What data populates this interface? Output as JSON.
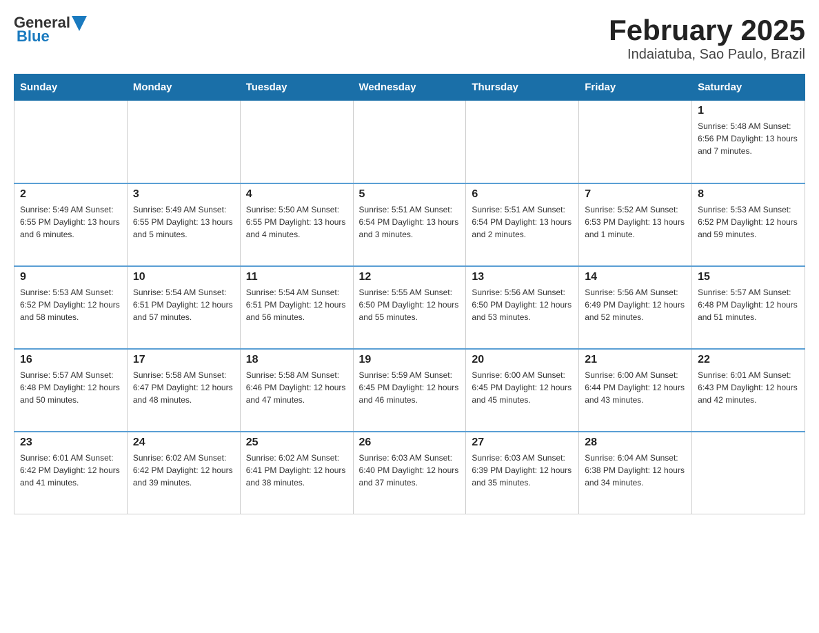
{
  "header": {
    "logo_general": "General",
    "logo_blue": "Blue",
    "month_title": "February 2025",
    "location": "Indaiatuba, Sao Paulo, Brazil"
  },
  "weekdays": [
    "Sunday",
    "Monday",
    "Tuesday",
    "Wednesday",
    "Thursday",
    "Friday",
    "Saturday"
  ],
  "rows": [
    {
      "cells": [
        {
          "day": "",
          "info": ""
        },
        {
          "day": "",
          "info": ""
        },
        {
          "day": "",
          "info": ""
        },
        {
          "day": "",
          "info": ""
        },
        {
          "day": "",
          "info": ""
        },
        {
          "day": "",
          "info": ""
        },
        {
          "day": "1",
          "info": "Sunrise: 5:48 AM\nSunset: 6:56 PM\nDaylight: 13 hours and 7 minutes."
        }
      ]
    },
    {
      "cells": [
        {
          "day": "2",
          "info": "Sunrise: 5:49 AM\nSunset: 6:55 PM\nDaylight: 13 hours and 6 minutes."
        },
        {
          "day": "3",
          "info": "Sunrise: 5:49 AM\nSunset: 6:55 PM\nDaylight: 13 hours and 5 minutes."
        },
        {
          "day": "4",
          "info": "Sunrise: 5:50 AM\nSunset: 6:55 PM\nDaylight: 13 hours and 4 minutes."
        },
        {
          "day": "5",
          "info": "Sunrise: 5:51 AM\nSunset: 6:54 PM\nDaylight: 13 hours and 3 minutes."
        },
        {
          "day": "6",
          "info": "Sunrise: 5:51 AM\nSunset: 6:54 PM\nDaylight: 13 hours and 2 minutes."
        },
        {
          "day": "7",
          "info": "Sunrise: 5:52 AM\nSunset: 6:53 PM\nDaylight: 13 hours and 1 minute."
        },
        {
          "day": "8",
          "info": "Sunrise: 5:53 AM\nSunset: 6:52 PM\nDaylight: 12 hours and 59 minutes."
        }
      ]
    },
    {
      "cells": [
        {
          "day": "9",
          "info": "Sunrise: 5:53 AM\nSunset: 6:52 PM\nDaylight: 12 hours and 58 minutes."
        },
        {
          "day": "10",
          "info": "Sunrise: 5:54 AM\nSunset: 6:51 PM\nDaylight: 12 hours and 57 minutes."
        },
        {
          "day": "11",
          "info": "Sunrise: 5:54 AM\nSunset: 6:51 PM\nDaylight: 12 hours and 56 minutes."
        },
        {
          "day": "12",
          "info": "Sunrise: 5:55 AM\nSunset: 6:50 PM\nDaylight: 12 hours and 55 minutes."
        },
        {
          "day": "13",
          "info": "Sunrise: 5:56 AM\nSunset: 6:50 PM\nDaylight: 12 hours and 53 minutes."
        },
        {
          "day": "14",
          "info": "Sunrise: 5:56 AM\nSunset: 6:49 PM\nDaylight: 12 hours and 52 minutes."
        },
        {
          "day": "15",
          "info": "Sunrise: 5:57 AM\nSunset: 6:48 PM\nDaylight: 12 hours and 51 minutes."
        }
      ]
    },
    {
      "cells": [
        {
          "day": "16",
          "info": "Sunrise: 5:57 AM\nSunset: 6:48 PM\nDaylight: 12 hours and 50 minutes."
        },
        {
          "day": "17",
          "info": "Sunrise: 5:58 AM\nSunset: 6:47 PM\nDaylight: 12 hours and 48 minutes."
        },
        {
          "day": "18",
          "info": "Sunrise: 5:58 AM\nSunset: 6:46 PM\nDaylight: 12 hours and 47 minutes."
        },
        {
          "day": "19",
          "info": "Sunrise: 5:59 AM\nSunset: 6:45 PM\nDaylight: 12 hours and 46 minutes."
        },
        {
          "day": "20",
          "info": "Sunrise: 6:00 AM\nSunset: 6:45 PM\nDaylight: 12 hours and 45 minutes."
        },
        {
          "day": "21",
          "info": "Sunrise: 6:00 AM\nSunset: 6:44 PM\nDaylight: 12 hours and 43 minutes."
        },
        {
          "day": "22",
          "info": "Sunrise: 6:01 AM\nSunset: 6:43 PM\nDaylight: 12 hours and 42 minutes."
        }
      ]
    },
    {
      "cells": [
        {
          "day": "23",
          "info": "Sunrise: 6:01 AM\nSunset: 6:42 PM\nDaylight: 12 hours and 41 minutes."
        },
        {
          "day": "24",
          "info": "Sunrise: 6:02 AM\nSunset: 6:42 PM\nDaylight: 12 hours and 39 minutes."
        },
        {
          "day": "25",
          "info": "Sunrise: 6:02 AM\nSunset: 6:41 PM\nDaylight: 12 hours and 38 minutes."
        },
        {
          "day": "26",
          "info": "Sunrise: 6:03 AM\nSunset: 6:40 PM\nDaylight: 12 hours and 37 minutes."
        },
        {
          "day": "27",
          "info": "Sunrise: 6:03 AM\nSunset: 6:39 PM\nDaylight: 12 hours and 35 minutes."
        },
        {
          "day": "28",
          "info": "Sunrise: 6:04 AM\nSunset: 6:38 PM\nDaylight: 12 hours and 34 minutes."
        },
        {
          "day": "",
          "info": ""
        }
      ]
    }
  ]
}
